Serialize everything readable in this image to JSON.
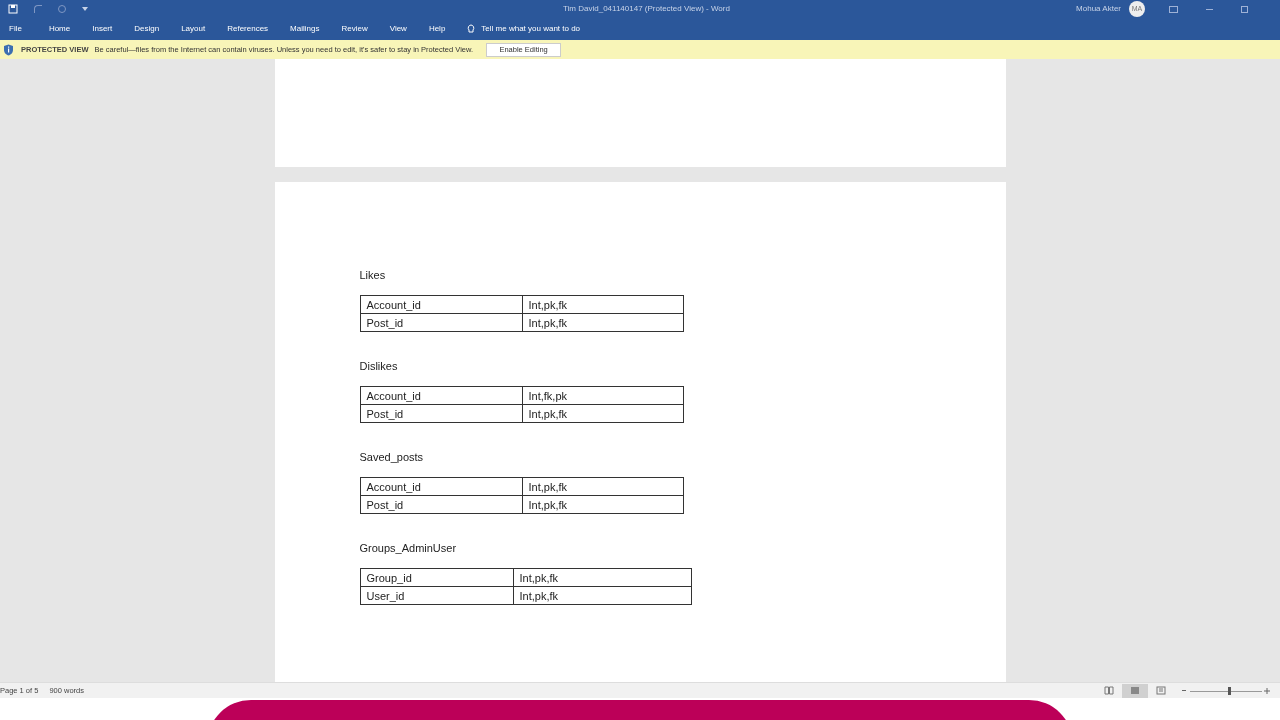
{
  "window": {
    "title": "Tim David_041140147 (Protected View) - Word",
    "user": "Mohua Akter",
    "avatar": "MA"
  },
  "ribbon_tabs": [
    {
      "label": "File"
    },
    {
      "label": "Home"
    },
    {
      "label": "Insert"
    },
    {
      "label": "Design"
    },
    {
      "label": "Layout"
    },
    {
      "label": "References"
    },
    {
      "label": "Mailings"
    },
    {
      "label": "Review"
    },
    {
      "label": "View"
    },
    {
      "label": "Help"
    }
  ],
  "tell_me": "Tell me what you want to do",
  "protected_view": {
    "title": "PROTECTED VIEW",
    "message": "Be careful—files from the Internet can contain viruses. Unless you need to edit, it's safer to stay in Protected View.",
    "button": "Enable Editing"
  },
  "document": {
    "tables": [
      {
        "title": "Likes",
        "wide": false,
        "rows": [
          [
            "Account_id",
            "Int,pk,fk"
          ],
          [
            "Post_id",
            "Int,pk,fk"
          ]
        ]
      },
      {
        "title": "Dislikes",
        "wide": false,
        "rows": [
          [
            "Account_id",
            "Int,fk,pk"
          ],
          [
            "Post_id",
            "Int,pk,fk"
          ]
        ]
      },
      {
        "title": "Saved_posts",
        "wide": false,
        "rows": [
          [
            "Account_id",
            "Int,pk,fk"
          ],
          [
            "Post_id",
            "Int,pk,fk"
          ]
        ]
      },
      {
        "title": "Groups_AdminUser",
        "wide": true,
        "rows": [
          [
            "Group_id",
            "Int,pk,fk"
          ],
          [
            "User_id",
            "Int,pk,fk"
          ]
        ]
      }
    ]
  },
  "status_bar": {
    "page": "Page 1 of 5",
    "words": "900 words",
    "views": [
      {
        "selected": false
      },
      {
        "selected": true
      },
      {
        "selected": false
      }
    ],
    "zoom": {
      "level": 0.55
    }
  }
}
